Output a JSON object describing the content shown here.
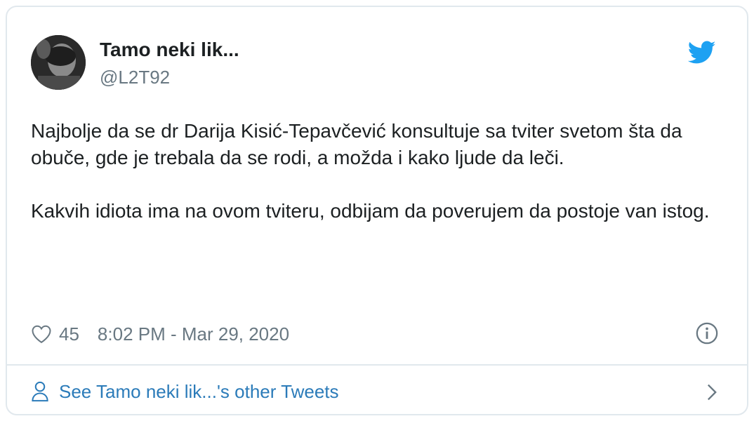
{
  "user": {
    "name": "Tamo neki lik...",
    "handle": "@L2T92",
    "avatar_icon": "profile-photo"
  },
  "tweet": {
    "paragraphs": [
      "Najbolje da se dr Darija Kisić-Tepavčević konsultuje sa tviter svetom šta da obuče, gde je trebala da se rodi, a možda i kako ljude da leči.",
      "Kakvih idiota ima na ovom tviteru, odbijam da poverujem da postoje van istog."
    ]
  },
  "meta": {
    "like_count": "45",
    "timestamp": "8:02 PM - Mar 29, 2020"
  },
  "footer": {
    "link_label": "See Tamo neki lik...'s other Tweets"
  },
  "icons": {
    "brand": "twitter-bird-icon",
    "like": "heart-icon",
    "info": "info-icon",
    "profile": "person-icon",
    "more": "chevron-right-icon"
  },
  "colors": {
    "brand": "#1da1f2",
    "link": "#2b7bb9",
    "muted": "#697882",
    "border": "#e1e8ed",
    "text": "#1c2022"
  }
}
